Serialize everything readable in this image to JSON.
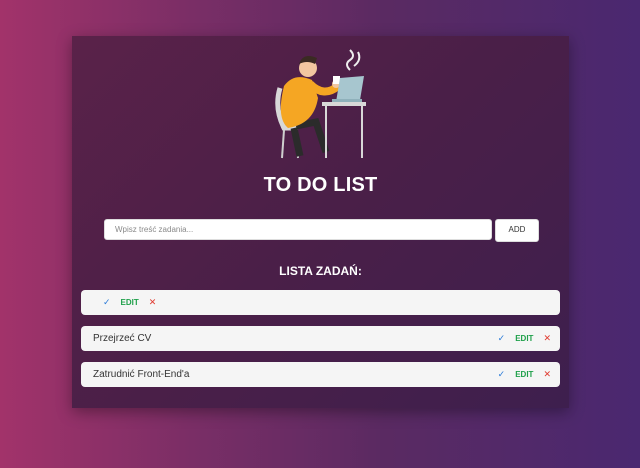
{
  "app": {
    "title": "TO DO LIST"
  },
  "form": {
    "placeholder": "Wpisz treść zadania...",
    "add_label": "ADD"
  },
  "list": {
    "heading": "LISTA ZADAŃ:",
    "items": [
      {
        "text": "",
        "check": "✓",
        "edit": "EDIT",
        "delete": "✕"
      },
      {
        "text": "Przejrzeć CV",
        "check": "✓",
        "edit": "EDIT",
        "delete": "✕"
      },
      {
        "text": "Zatrudnić Front-End'a",
        "check": "✓",
        "edit": "EDIT",
        "delete": "✕"
      }
    ]
  },
  "colors": {
    "accent_check": "#2b7bd8",
    "accent_edit": "#1fa04a",
    "accent_delete": "#e03a2f"
  }
}
